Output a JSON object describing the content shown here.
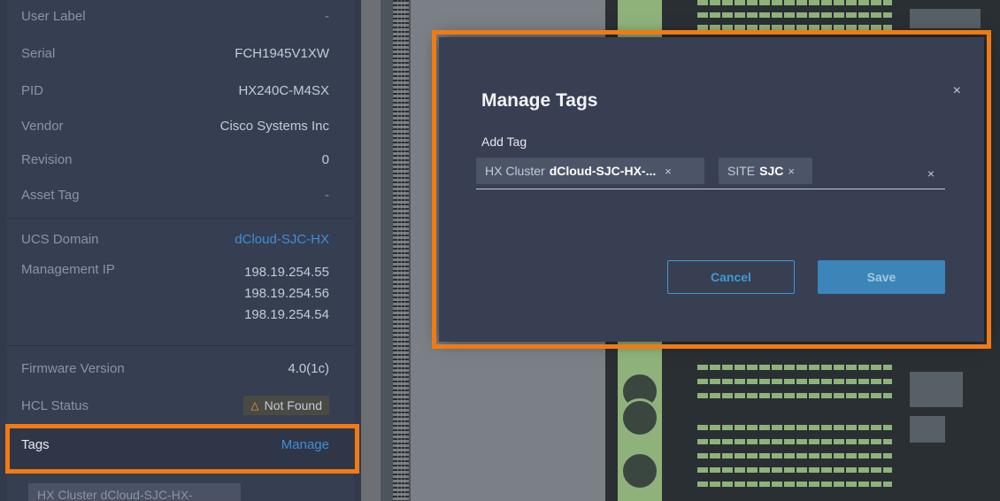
{
  "details": {
    "rows": [
      {
        "key": "User Label",
        "value": "-"
      },
      {
        "key": "Serial",
        "value": "FCH1945V1XW"
      },
      {
        "key": "PID",
        "value": "HX240C-M4SX"
      },
      {
        "key": "Vendor",
        "value": "Cisco Systems Inc"
      },
      {
        "key": "Revision",
        "value": "0"
      },
      {
        "key": "Asset Tag",
        "value": "-"
      }
    ],
    "ucs_domain": {
      "key": "UCS Domain",
      "value": "dCloud-SJC-HX"
    },
    "management_ip": {
      "key": "Management IP",
      "values": [
        "198.19.254.55",
        "198.19.254.56",
        "198.19.254.54"
      ]
    },
    "firmware": {
      "key": "Firmware Version",
      "value": "4.0(1c)"
    },
    "hcl": {
      "key": "HCL Status",
      "value": "Not Found"
    },
    "tags": {
      "key": "Tags",
      "action": "Manage"
    },
    "tag_chip": {
      "key": "HX Cluster",
      "value": "dCloud-SJC-HX-"
    }
  },
  "modal": {
    "title": "Manage Tags",
    "close": "×",
    "field_label": "Add Tag",
    "chips": [
      {
        "key": "HX Cluster",
        "value": "dCloud-SJC-HX-...",
        "remove": "×"
      },
      {
        "key": "SITE",
        "value": "SJC",
        "remove": "×"
      }
    ],
    "clear": "×",
    "cancel_label": "Cancel",
    "save_label": "Save"
  },
  "colors": {
    "highlight": "#f27a12",
    "link": "#3d8fd6",
    "primary_button": "#3b85b8",
    "warning": "#e8a23d"
  },
  "icons": {
    "warning": "warning-triangle-icon",
    "close": "close-icon"
  }
}
